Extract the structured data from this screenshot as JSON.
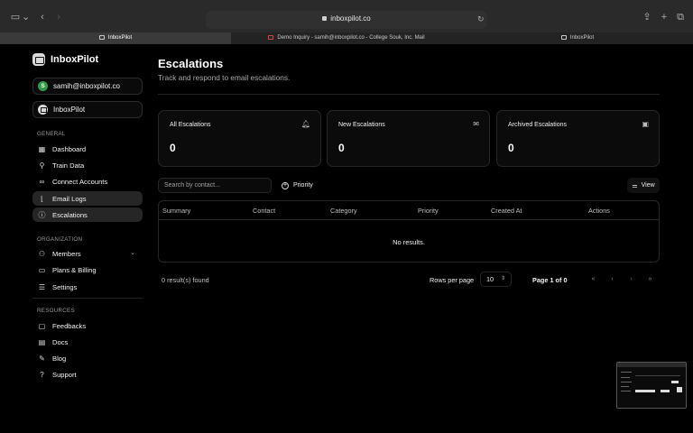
{
  "browser": {
    "url": "inboxpilot.co",
    "tabs": [
      {
        "title": "InboxPilot",
        "active": true
      },
      {
        "title": "Demo Inquiry - samih@inboxpilot.co - College Souk, Inc. Mail",
        "active": false
      },
      {
        "title": "InboxPilot",
        "active": false
      }
    ]
  },
  "sidebar": {
    "brand": "InboxPilot",
    "account_email": "samih@inboxpilot.co",
    "account_initial": "S",
    "workspace": "InboxPilot",
    "sections": {
      "general": "GENERAL",
      "organization": "ORGANIZATION",
      "resources": "RESOURCES"
    },
    "general_items": [
      "Dashboard",
      "Train Data",
      "Connect Accounts",
      "Email Logs",
      "Escalations"
    ],
    "organization_items": [
      "Members",
      "Plans & Billing",
      "Settings"
    ],
    "resources_items": [
      "Feedbacks",
      "Docs",
      "Blog",
      "Support"
    ]
  },
  "main": {
    "title": "Escalations",
    "subtitle": "Track and respond to email escalations.",
    "cards": [
      {
        "title": "All Escalations",
        "value": "0",
        "icon": "bell-icon"
      },
      {
        "title": "New Escalations",
        "value": "0",
        "icon": "inbox-icon"
      },
      {
        "title": "Archived Escalations",
        "value": "0",
        "icon": "archive-icon"
      }
    ],
    "search_placeholder": "Search by contact...",
    "filter_label": "Priority",
    "view_label": "View",
    "columns": [
      "Summary",
      "Contact",
      "Category",
      "Priority",
      "Created At",
      "Actions"
    ],
    "empty_text": "No results.",
    "results_count": "0 result(s) found",
    "rows_per_page_label": "Rows per page",
    "rows_per_page_value": "10",
    "page_label": "Page 1 of 0"
  },
  "colors": {
    "background": "#000000",
    "card_border": "#262626",
    "active_nav": "#262626",
    "avatar": "#2f9b48"
  }
}
